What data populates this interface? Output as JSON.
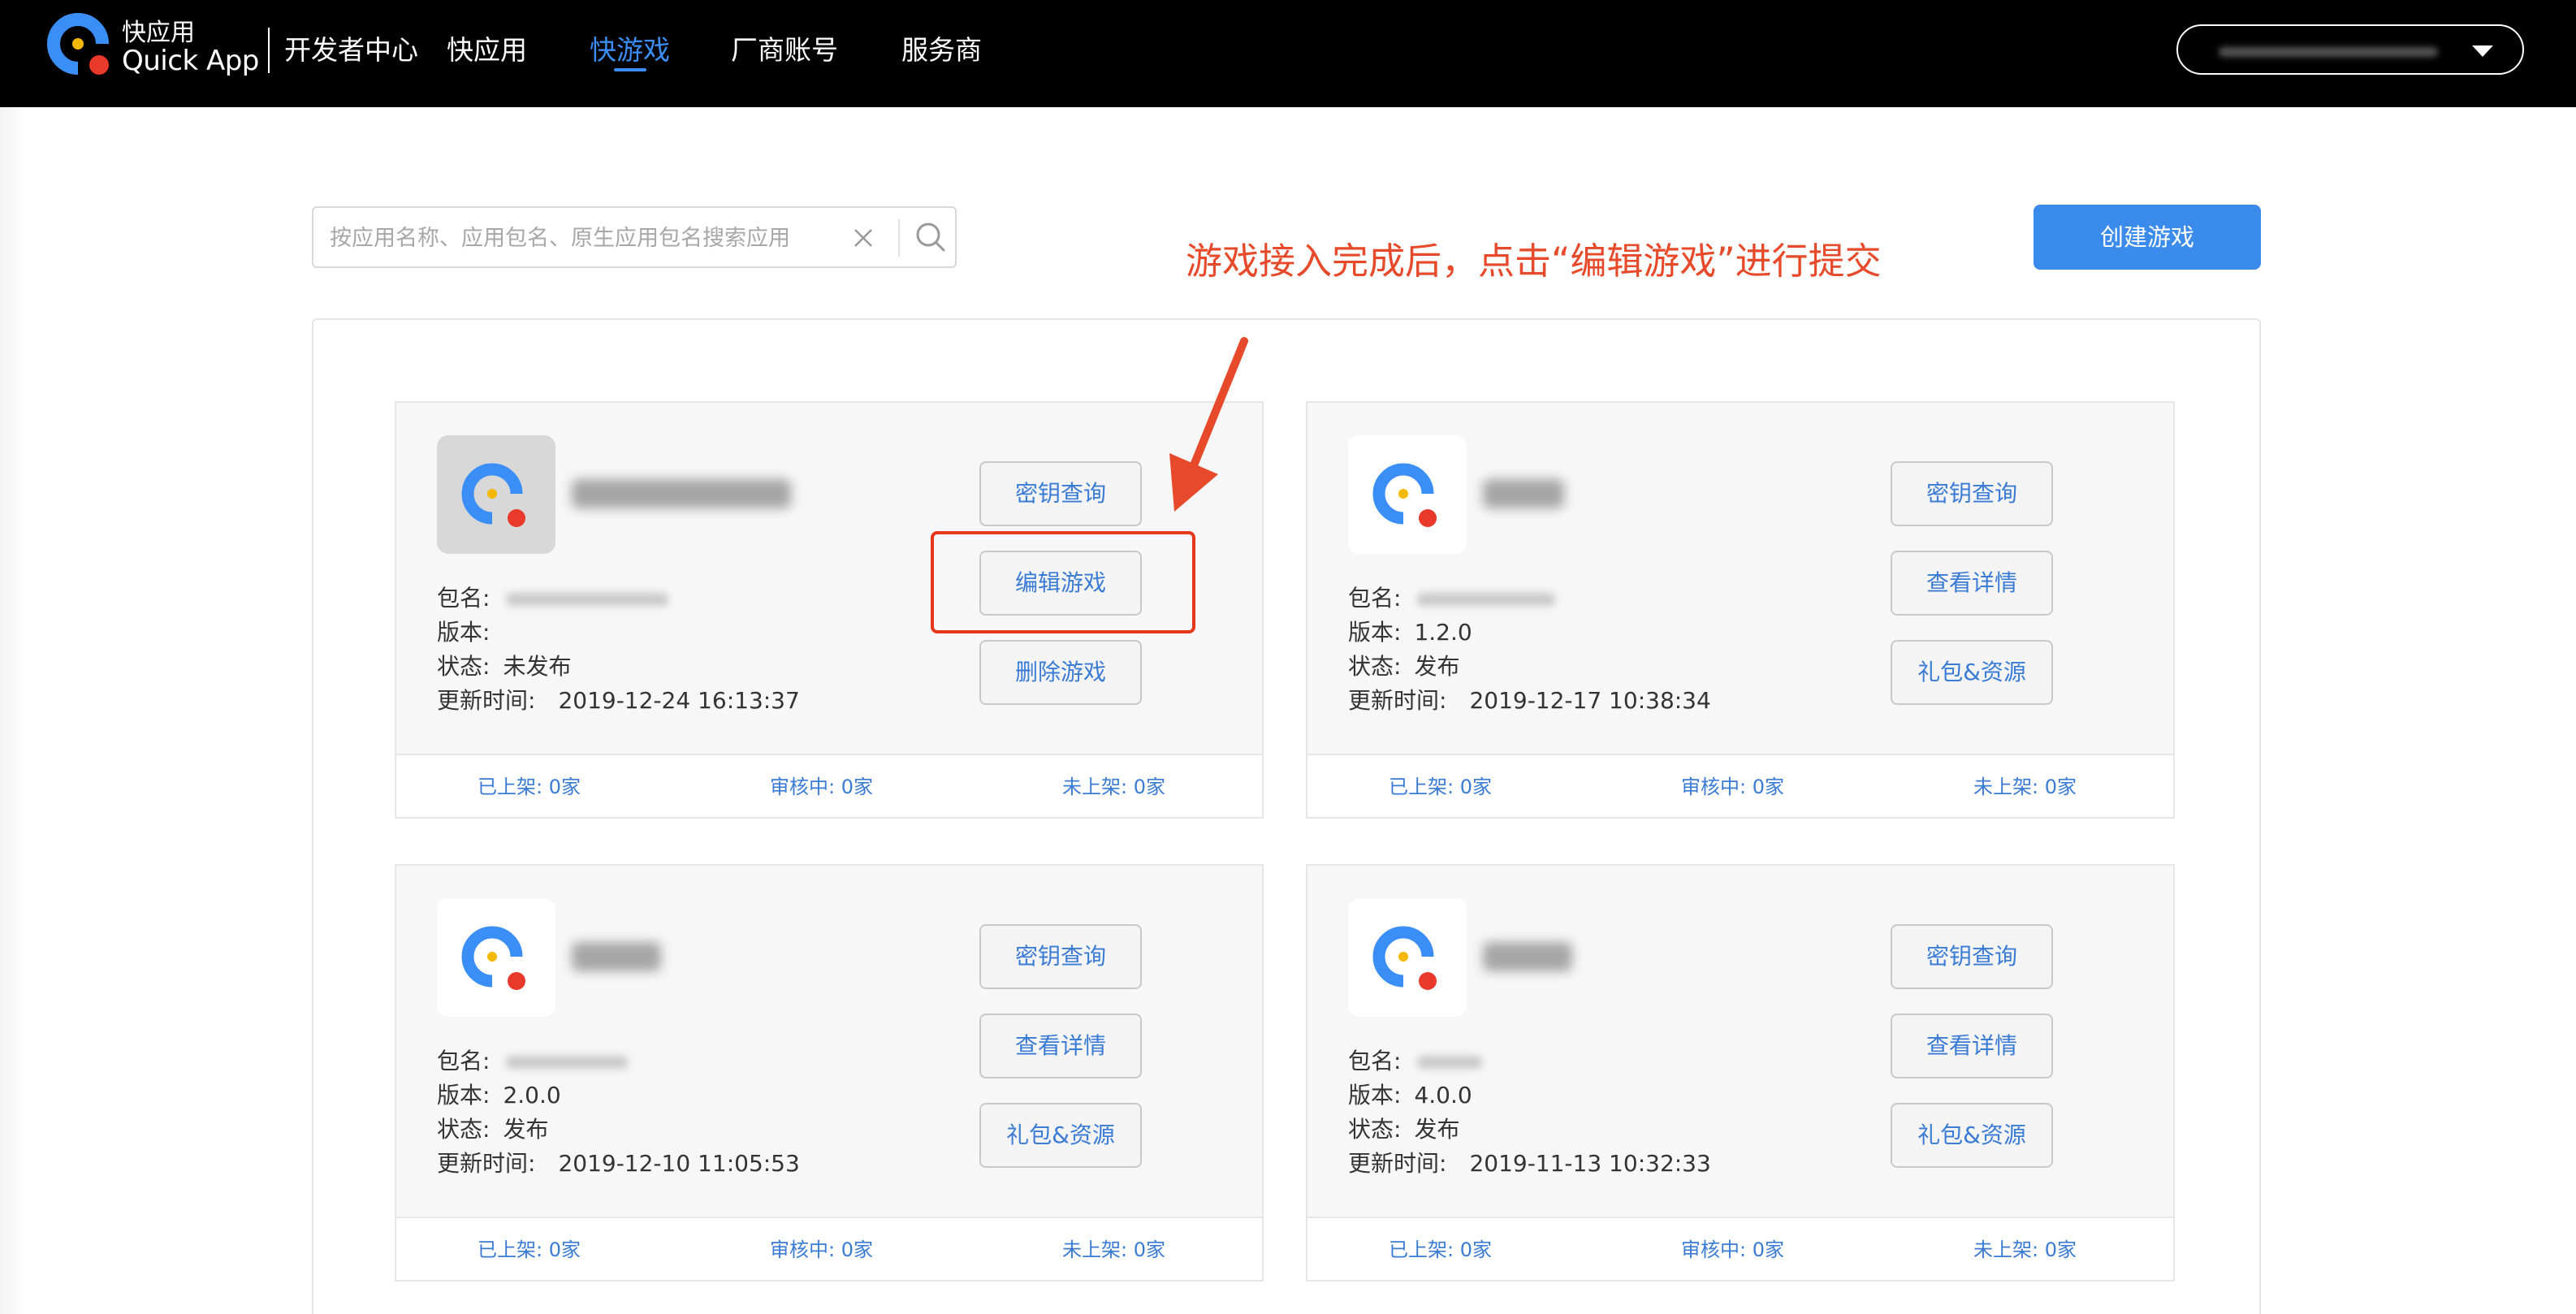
{
  "brand": {
    "name_cn": "快应用",
    "name_en": "Quick App"
  },
  "nav": [
    {
      "label": "开发者中心",
      "active": false
    },
    {
      "label": "快应用",
      "active": false
    },
    {
      "label": "快游戏",
      "active": true
    },
    {
      "label": "厂商账号",
      "active": false
    },
    {
      "label": "服务商",
      "active": false
    }
  ],
  "colors": {
    "accent": "#3a8ef6",
    "button_primary": "#3b8bec",
    "annotation": "#e64a2a",
    "topbar": "#000000"
  },
  "search": {
    "placeholder": "按应用名称、应用包名、原生应用包名搜索应用",
    "value": ""
  },
  "create_button": "创建游戏",
  "annotation": "游戏接入完成后，点击“编辑游戏”进行提交",
  "labels": {
    "package": "包名:",
    "version": "版本:",
    "status": "状态:",
    "updated": "更新时间:",
    "listed": "已上架:",
    "reviewing": "审核中:",
    "unlisted": "未上架:"
  },
  "cards": [
    {
      "version": "",
      "status": "未发布",
      "updated": "2019-12-24 16:13:37",
      "buttons": [
        "密钥查询",
        "编辑游戏",
        "删除游戏"
      ],
      "listed": "0家",
      "reviewing": "0家",
      "unlisted": "0家"
    },
    {
      "version": "1.2.0",
      "status": "发布",
      "updated": "2019-12-17 10:38:34",
      "buttons": [
        "密钥查询",
        "查看详情",
        "礼包&资源"
      ],
      "listed": "0家",
      "reviewing": "0家",
      "unlisted": "0家"
    },
    {
      "version": "2.0.0",
      "status": "发布",
      "updated": "2019-12-10 11:05:53",
      "buttons": [
        "密钥查询",
        "查看详情",
        "礼包&资源"
      ],
      "listed": "0家",
      "reviewing": "0家",
      "unlisted": "0家"
    },
    {
      "version": "4.0.0",
      "status": "发布",
      "updated": "2019-11-13 10:32:33",
      "buttons": [
        "密钥查询",
        "查看详情",
        "礼包&资源"
      ],
      "listed": "0家",
      "reviewing": "0家",
      "unlisted": "0家"
    }
  ]
}
